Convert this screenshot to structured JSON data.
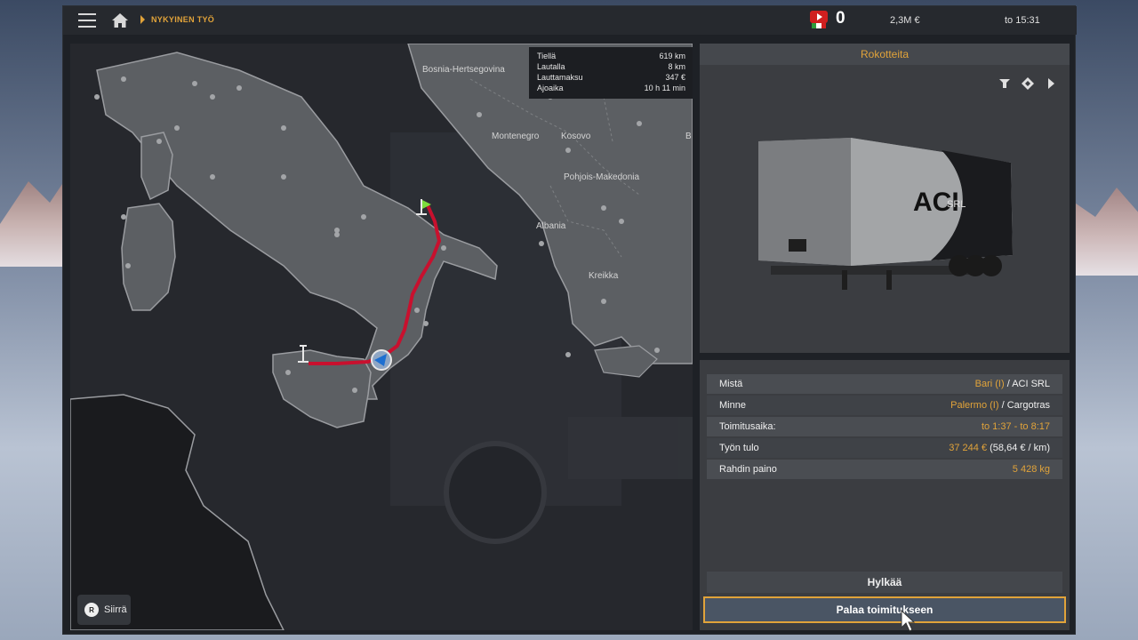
{
  "topbar": {
    "breadcrumb": "NYKYINEN TYÖ",
    "flag_count": "0",
    "money": "2,3M  €",
    "clock": "to 15:31"
  },
  "route": {
    "rows": [
      {
        "label": "Tiellä",
        "value": "619 km"
      },
      {
        "label": "Lautalla",
        "value": "8 km"
      },
      {
        "label": "Lauttamaksu",
        "value": "347 €"
      },
      {
        "label": "Ajoaika",
        "value": "10 h 11 min"
      }
    ]
  },
  "map": {
    "countries": [
      "Bosnia-Hertsegovina",
      "Montenegro",
      "Kosovo",
      "Pohjois-Makedonia",
      "Albania",
      "Kreikka",
      "B"
    ],
    "move_key": "R",
    "move_label": "Siirrä",
    "route_color": "#c8102e",
    "start_flag_color": "#7ddc3c"
  },
  "trailer": {
    "title": "Rokotteita",
    "brand": "ACI",
    "brand_sub": "SRL",
    "tools": [
      "trailer-icon",
      "diamond-marker-icon",
      "play-arrow-icon"
    ]
  },
  "details": {
    "from": {
      "label": "Mistä",
      "city": "Bari (I)",
      "company": " / ACI SRL"
    },
    "to": {
      "label": "Minne",
      "city": "Palermo (I)",
      "company": " / Cargotras"
    },
    "time": {
      "label": "Toimitusaika:",
      "value": "to 1:37 - to 8:17"
    },
    "income": {
      "label": "Työn tulo",
      "value": "37 244 €",
      "extra": " (58,64 € / km)"
    },
    "weight": {
      "label": "Rahdin paino",
      "value": "5 428 kg"
    }
  },
  "buttons": {
    "reject": "Hylkää",
    "return": "Palaa toimitukseen"
  },
  "colors": {
    "accent": "#e1a33a",
    "panel": "#3b3d41"
  }
}
